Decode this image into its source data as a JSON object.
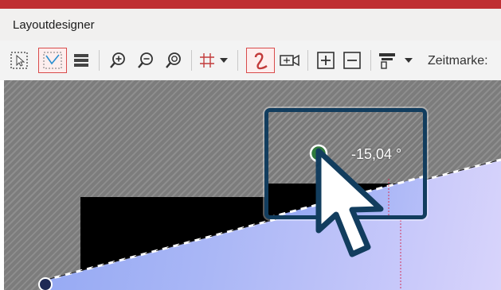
{
  "window": {
    "title": "Layoutdesigner",
    "accent_color": "#bf2f32"
  },
  "toolbar": {
    "tools": [
      {
        "name": "select-tool-icon",
        "active": false
      },
      {
        "name": "path-select-tool-icon",
        "active": true
      },
      {
        "name": "layers-icon",
        "active": false
      },
      {
        "name": "zoom-in-icon",
        "active": false
      },
      {
        "name": "zoom-out-icon",
        "active": false
      },
      {
        "name": "zoom-fit-icon",
        "active": false
      },
      {
        "name": "grid-icon",
        "active": false
      },
      {
        "name": "grid-dropdown-icon",
        "active": false
      },
      {
        "name": "curve-path-icon",
        "active": true
      },
      {
        "name": "camera-icon",
        "active": false
      },
      {
        "name": "add-keyframe-icon",
        "active": false
      },
      {
        "name": "remove-keyframe-icon",
        "active": false
      },
      {
        "name": "align-icon",
        "active": false
      },
      {
        "name": "align-dropdown-icon",
        "active": false
      }
    ],
    "zeitmarke_label": "Zeitmarke:"
  },
  "canvas": {
    "rotation_angle_text": "-15,04 °",
    "background": "hatched-gray",
    "image_layer_color": "#a9b6f6",
    "magnifier_border_color": "#123d5e"
  }
}
